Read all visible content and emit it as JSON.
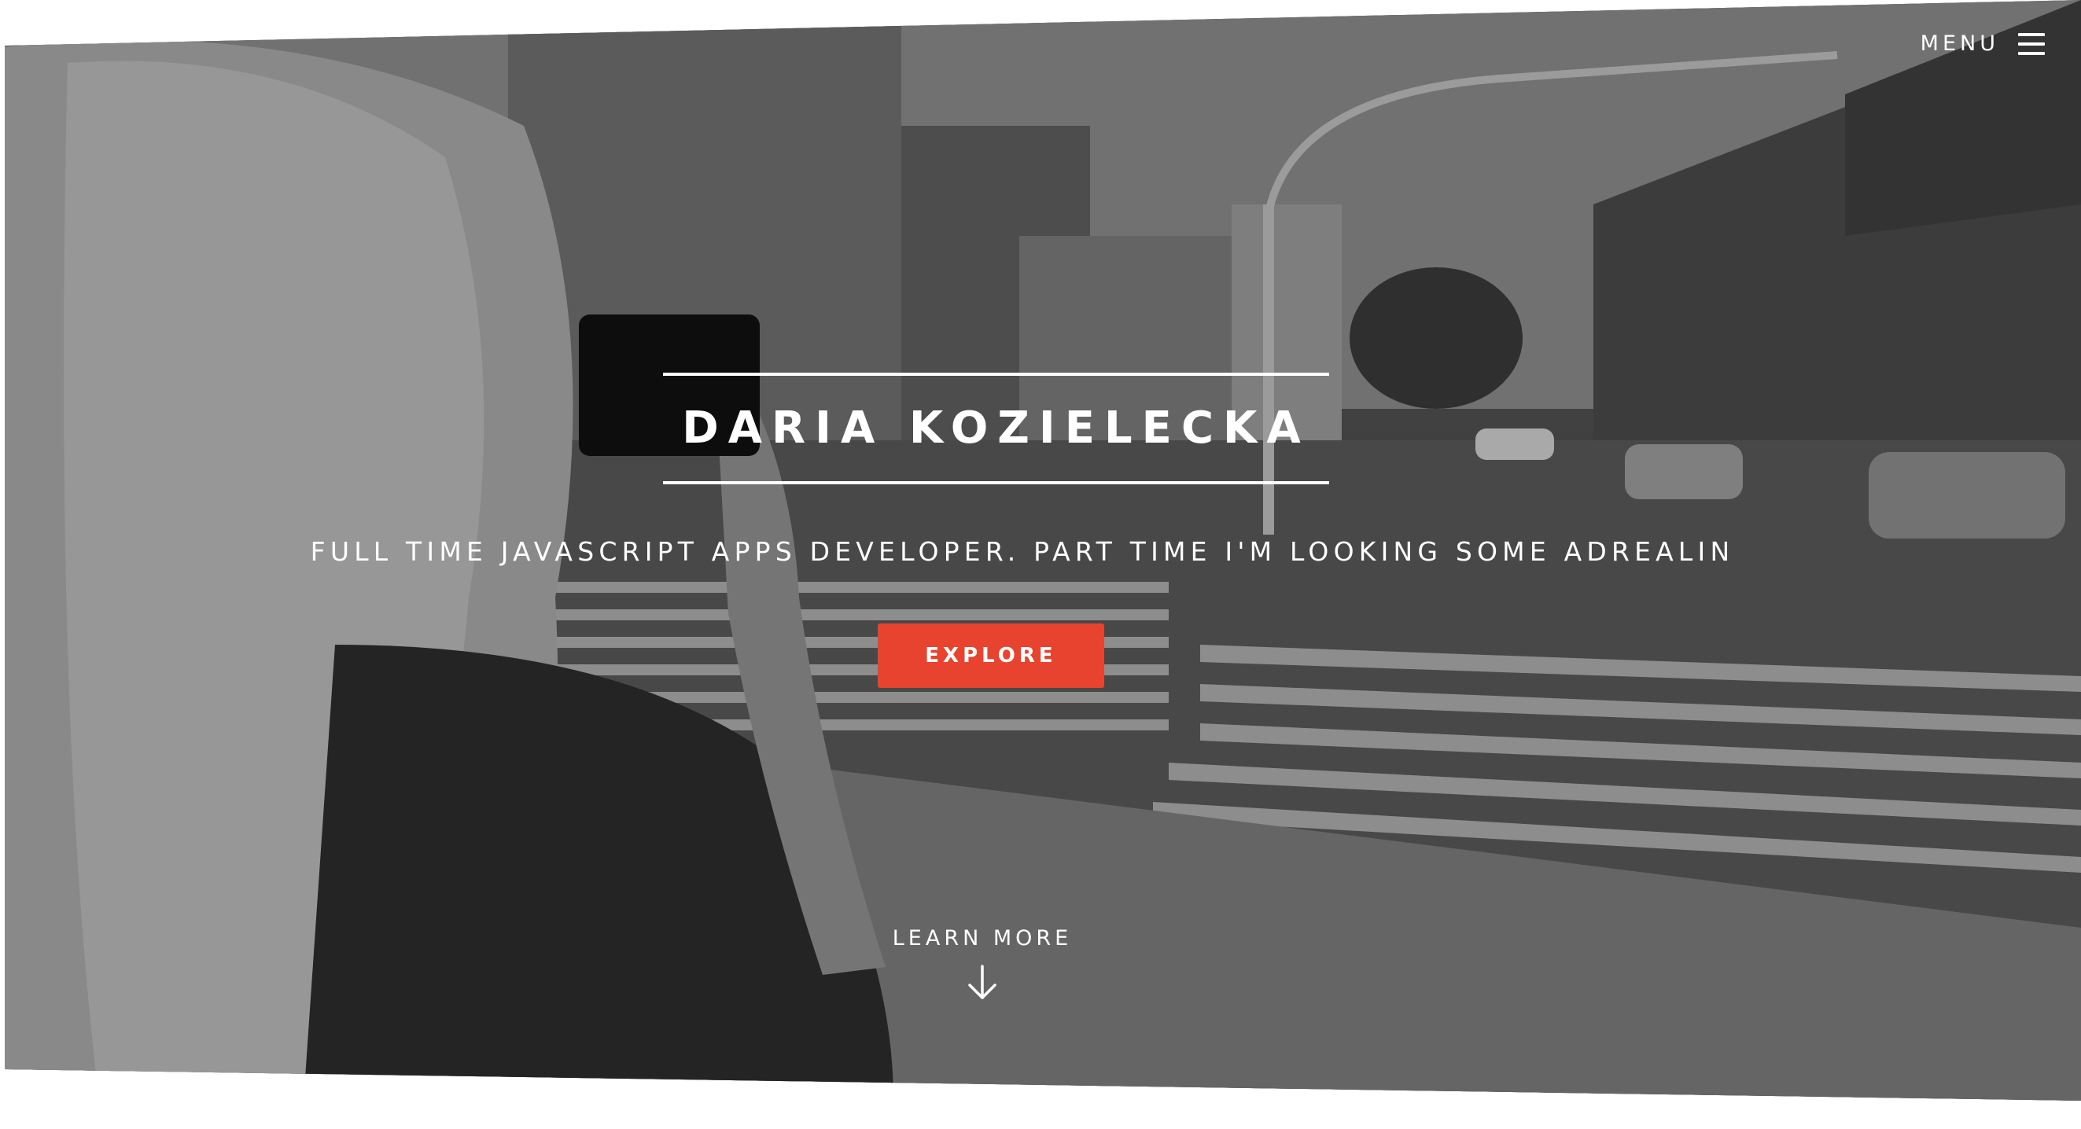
{
  "header": {
    "menu_label": "MENU",
    "menu_icon": "hamburger-icon"
  },
  "hero": {
    "title": "DARIA KOZIELECKA",
    "tagline": "FULL TIME JAVASCRIPT APPS DEVELOPER. PART TIME I'M LOOKING SOME ADREALIN",
    "cta_label": "EXPLORE",
    "learn_more_label": "LEARN MORE",
    "learn_more_icon": "arrow-down-icon",
    "background": "Black and white street photo of a woman photographing a city crossing"
  },
  "colors": {
    "accent": "#e8432e",
    "text": "#ffffff"
  }
}
